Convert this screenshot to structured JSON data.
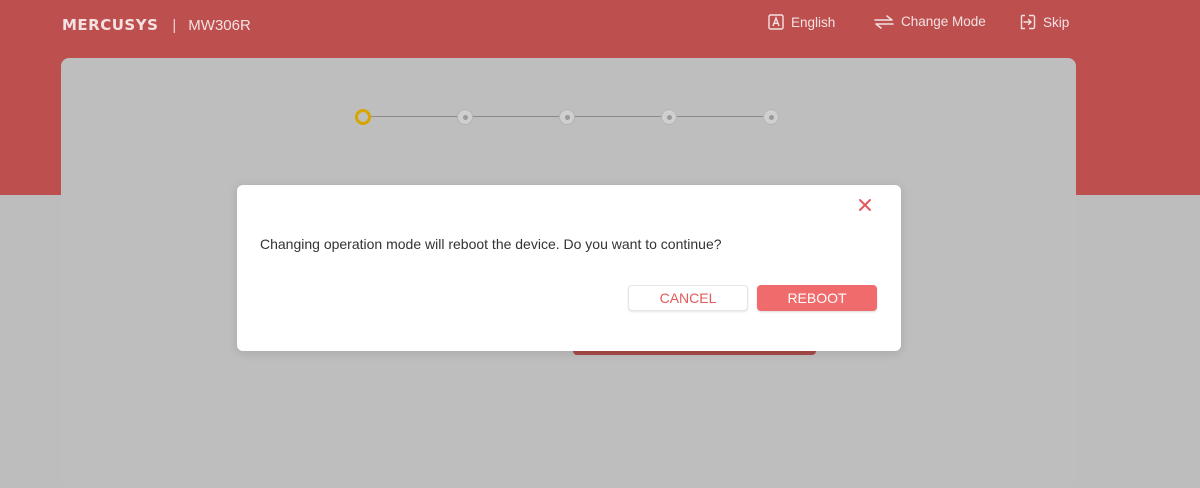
{
  "header": {
    "brand": "MERCUSYS",
    "separator": "|",
    "model": "MW306R",
    "language_label": "English",
    "mode_label": "Change Mode",
    "skip_label": "Skip"
  },
  "stepper": {
    "total_steps": 5,
    "current_step": 1
  },
  "dialog": {
    "message": "Changing operation mode will reboot the device. Do you want to continue?",
    "cancel_label": "CANCEL",
    "reboot_label": "REBOOT"
  },
  "colors": {
    "brand_red": "#e35a5a",
    "primary_button": "#f06b6b",
    "active_step": "#d8a400"
  },
  "icons": {
    "language": "language-icon",
    "mode": "swap-arrows-icon",
    "skip": "exit-icon",
    "close": "close-icon"
  }
}
